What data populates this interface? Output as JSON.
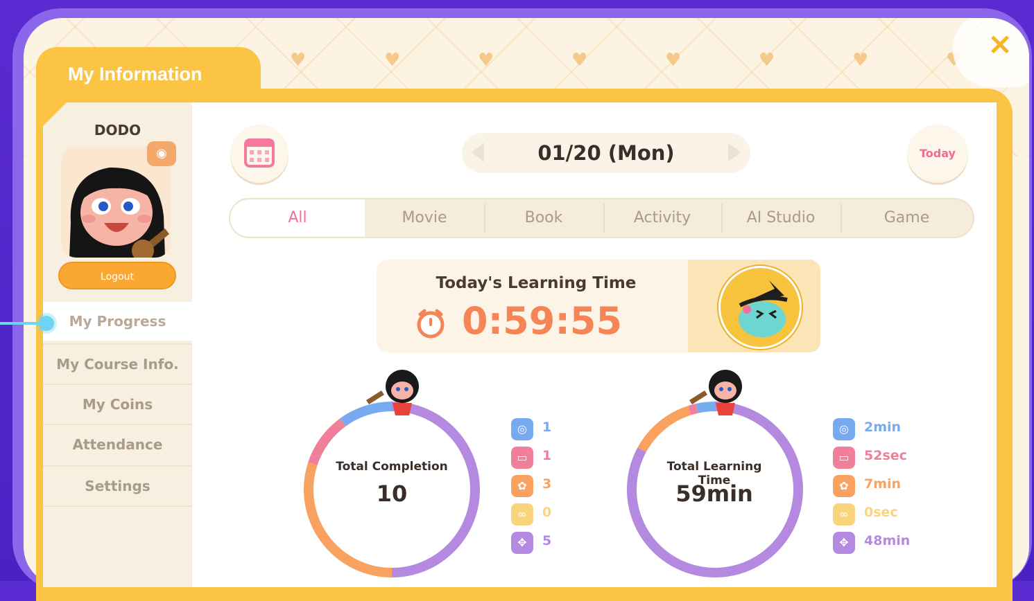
{
  "panel": {
    "title": "My Information",
    "close_icon": "×"
  },
  "profile": {
    "username": "DODO",
    "logout_label": "Logout"
  },
  "sidebar": {
    "items": [
      {
        "label": "My Progress",
        "active": true
      },
      {
        "label": "My Course Info."
      },
      {
        "label": "My Coins"
      },
      {
        "label": "Attendance"
      },
      {
        "label": "Settings"
      }
    ]
  },
  "date_nav": {
    "date": "01/20 (Mon)",
    "today_label": "Today"
  },
  "tabs": [
    "All",
    "Movie",
    "Book",
    "Activity",
    "AI Studio",
    "Game"
  ],
  "learning_time": {
    "title": "Today's Learning Time",
    "value": "0:59:55"
  },
  "completion": {
    "label": "Total Completion",
    "value": "10",
    "legend": [
      "1",
      "1",
      "3",
      "0",
      "5"
    ]
  },
  "learning_total": {
    "label": "Total Learning Time",
    "value": "59min",
    "legend": [
      "2min",
      "52sec",
      "7min",
      "0sec",
      "48min"
    ]
  },
  "colors": {
    "movie": "#78aaf0",
    "book": "#f07f9a",
    "activity": "#f9a15e",
    "ai_studio": "#f9d47a",
    "game": "#b489e0",
    "accent_pink": "#f0709b",
    "accent_orange": "#f58456"
  }
}
